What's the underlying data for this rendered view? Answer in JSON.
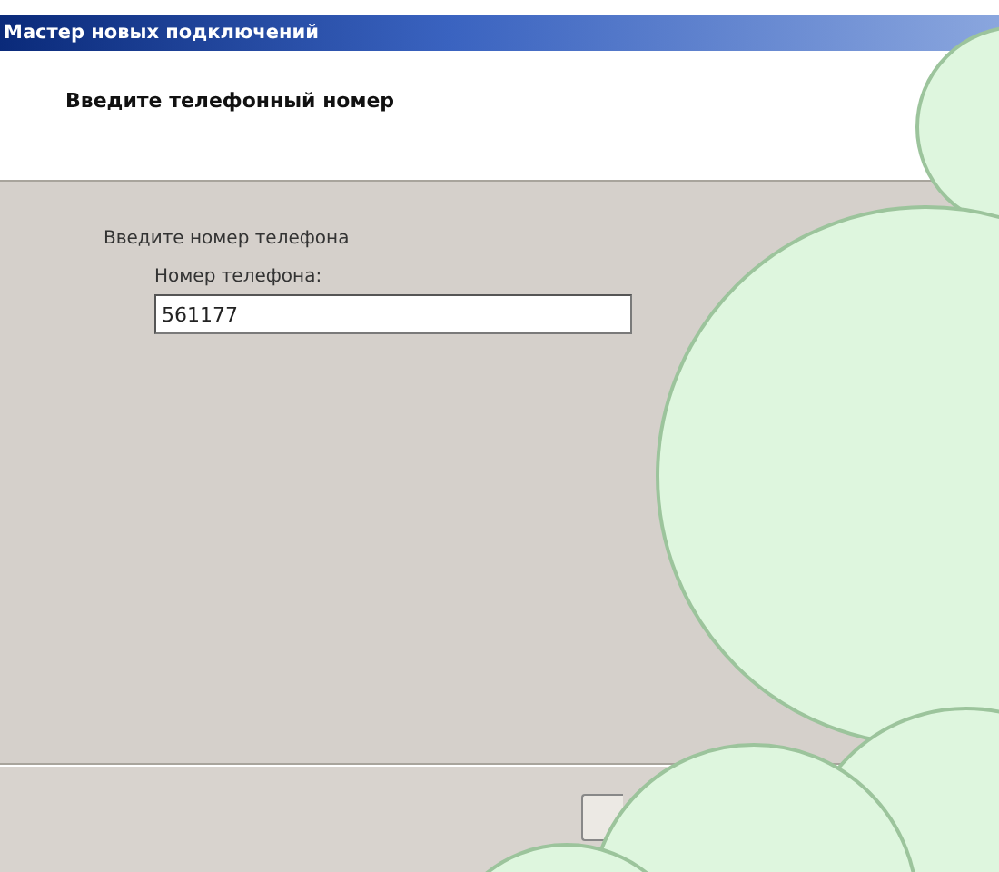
{
  "window": {
    "title": "Мастер новых подключений"
  },
  "header": {
    "title": "Введите телефонный номер"
  },
  "body": {
    "instruction": "Введите номер телефона",
    "phone_field": {
      "label": "Номер телефона:",
      "value": "561177"
    }
  }
}
